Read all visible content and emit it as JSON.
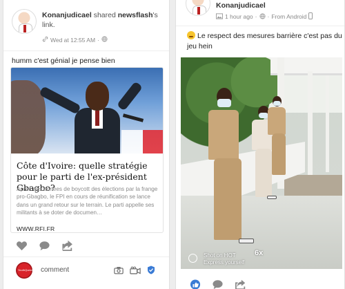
{
  "left_post": {
    "author": "Konanjudicael",
    "action_text": "shared",
    "source": "newsflash",
    "source_suffix": "'s",
    "link_word": "link.",
    "timestamp": "Wed at 12:55 AM",
    "timestamp_sep": "·",
    "body": "humm c'est génial je pense bien",
    "link_card": {
      "title": "Côte d'Ivoire: quelle stratégie pour le parti de l'ex-président Gbagbo?",
      "description": "Après des années de boycott des élections par la frange pro-Gbagbo, le FPI en cours de réunification se lance dans un grand retour sur le terrain. Le parti appelle ses militants à se doter de documen…",
      "domain": "WWW.RFI.FR"
    },
    "actions": [
      "heart-icon",
      "comment-bubble-icon",
      "share-arrow-icon"
    ],
    "comment_box": {
      "placeholder": "comment",
      "avatar_text": "YouthQuestions",
      "tools": [
        "camera-icon",
        "video-camera-icon",
        "emoji-shield-icon"
      ]
    }
  },
  "right_post": {
    "author": "Konanjudicael",
    "timestamp": "1 hour ago",
    "timestamp_sep": "·",
    "source_device": "From Android",
    "body": "Le respect des mesures barrière c'est pas du jeu hein",
    "photo_watermark_line1": "Shot on HOT",
    "photo_watermark_multiplier": "6x",
    "photo_watermark_line2": "Express yourself",
    "actions": [
      "like-icon",
      "comment-bubble-icon",
      "share-arrow-icon"
    ]
  },
  "colors": {
    "accent_blue": "#3a7bd5",
    "icon_gray": "#8a8a8a",
    "background": "#ededed"
  }
}
